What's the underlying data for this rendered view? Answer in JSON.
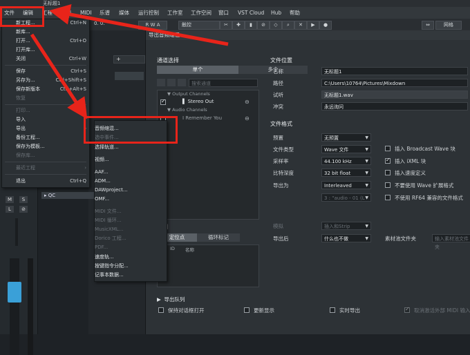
{
  "window": {
    "title": "无标题1"
  },
  "menubar": {
    "items": [
      "文件",
      "编辑",
      "工程",
      "音频",
      "MIDI",
      "乐谱",
      "媒体",
      "运行控制",
      "工作室",
      "工作空间",
      "窗口",
      "VST Cloud",
      "Hub",
      "帮助"
    ]
  },
  "toolbar": {
    "mode": "R W A",
    "touch_label": "触控",
    "grid": "小节",
    "right_label": "网格"
  },
  "transport": {
    "counter": "0. 0."
  },
  "file_menu": {
    "items": [
      {
        "label": "新工程...",
        "shortcut": "Ctrl+N",
        "disabled": false
      },
      {
        "label": "新库...",
        "shortcut": "",
        "disabled": false
      },
      {
        "label": "打开...",
        "shortcut": "Ctrl+O",
        "disabled": false
      },
      {
        "label": "打开库...",
        "shortcut": "",
        "disabled": false
      },
      {
        "label": "关闭",
        "shortcut": "Ctrl+W",
        "disabled": false
      },
      {
        "label": "保存",
        "shortcut": "Ctrl+S",
        "disabled": false
      },
      {
        "label": "另存为...",
        "shortcut": "Ctrl+Shift+S",
        "disabled": false
      },
      {
        "label": "保存新版本",
        "shortcut": "Ctrl+Alt+S",
        "disabled": false
      },
      {
        "label": "恢复",
        "shortcut": "",
        "disabled": true
      },
      {
        "label": "打印...",
        "shortcut": "",
        "disabled": true
      },
      {
        "label": "导入",
        "shortcut": "",
        "disabled": false
      },
      {
        "label": "导出",
        "shortcut": "",
        "disabled": false
      },
      {
        "label": "备份工程...",
        "shortcut": "",
        "disabled": false
      },
      {
        "label": "保存为模板...",
        "shortcut": "",
        "disabled": false
      },
      {
        "label": "保存库...",
        "shortcut": "",
        "disabled": true
      },
      {
        "label": "最近工程",
        "shortcut": "",
        "disabled": true
      },
      {
        "label": "退出",
        "shortcut": "Ctrl+Q",
        "disabled": false
      }
    ]
  },
  "export_menu": {
    "items": [
      {
        "label": "音频缩混...",
        "disabled": false
      },
      {
        "label": "选中事件...",
        "disabled": true
      },
      {
        "label": "选择轨道...",
        "disabled": false
      },
      {
        "label": "视频...",
        "disabled": false
      },
      {
        "label": "AAF...",
        "disabled": false
      },
      {
        "label": "ADM...",
        "disabled": false
      },
      {
        "label": "DAWproject...",
        "disabled": false
      },
      {
        "label": "OMF...",
        "disabled": false
      },
      {
        "label": "MIDI 文件...",
        "disabled": true
      },
      {
        "label": "MIDI 循环...",
        "disabled": true
      },
      {
        "label": "MusicXML...",
        "disabled": true
      },
      {
        "label": "Dorico 工程...",
        "disabled": true
      },
      {
        "label": "PDF...",
        "disabled": true
      },
      {
        "label": "速度轨...",
        "disabled": false
      },
      {
        "label": "按键指令分配...",
        "disabled": false
      },
      {
        "label": "记事本数据...",
        "disabled": false
      }
    ]
  },
  "track": {
    "name": "QC"
  },
  "dialog": {
    "title": "导出音频缩混",
    "channel_selection": {
      "heading": "通道选择",
      "tabs": [
        "单个",
        "多个"
      ],
      "search_placeholder": "搜索通道",
      "groups": [
        {
          "label": "Output Channels",
          "items": [
            {
              "name": "Stereo Out",
              "checked": true
            }
          ]
        },
        {
          "label": "Audio Channels",
          "items": [
            {
              "name": "I Remember You",
              "checked": false
            }
          ]
        }
      ]
    },
    "file_location": {
      "heading": "文件位置",
      "name_label": "名称",
      "name_value": "无标题1",
      "path_label": "路径",
      "path_value": "C:\\Users\\10764\\Pictures\\Mixdown",
      "preview_label": "试听",
      "preview_value": "无标题1.wav",
      "conflict_label": "冲突",
      "conflict_value": "永远询问"
    },
    "file_format": {
      "heading": "文件格式",
      "rows": [
        {
          "label": "预置",
          "value": "无预置"
        },
        {
          "label": "文件类型",
          "value": "Wave 文件"
        },
        {
          "label": "采样率",
          "value": "44.100 kHz"
        },
        {
          "label": "比特深度",
          "value": "32 bit float"
        },
        {
          "label": "导出为",
          "value": "Interleaved"
        }
      ],
      "sub_value": "3 : \"audio - 01 (L",
      "options": [
        {
          "label": "插入 Broadcast Wave 块",
          "checked": false
        },
        {
          "label": "插入 iXML 块",
          "checked": true
        },
        {
          "label": "插入速度定义",
          "checked": false
        },
        {
          "label": "不要使用 Wave 扩展格式",
          "checked": false
        },
        {
          "label": "不使用 RF64 兼容的文件格式",
          "checked": false
        }
      ]
    },
    "post": {
      "sim_label": "模拟",
      "sim_value": "插入和Strip",
      "after_label": "导出后",
      "after_value": "什么也不做",
      "pool_label": "素材池文件夹",
      "pool_placeholder": "输入素材池文件夹"
    },
    "range": {
      "heading": "范围",
      "tabs": [
        "定位点",
        "循环标记"
      ],
      "cols": [
        "ID",
        "名称"
      ]
    },
    "queue": {
      "heading": "导出队列",
      "options": [
        {
          "label": "保持对话框打开",
          "checked": false
        },
        {
          "label": "更新显示",
          "checked": false
        },
        {
          "label": "实时导出",
          "checked": false
        },
        {
          "label": "取消激活外部 MIDI 输入",
          "checked": true,
          "disabled": true
        }
      ]
    }
  },
  "annotations": {
    "color": "#e8241a"
  }
}
